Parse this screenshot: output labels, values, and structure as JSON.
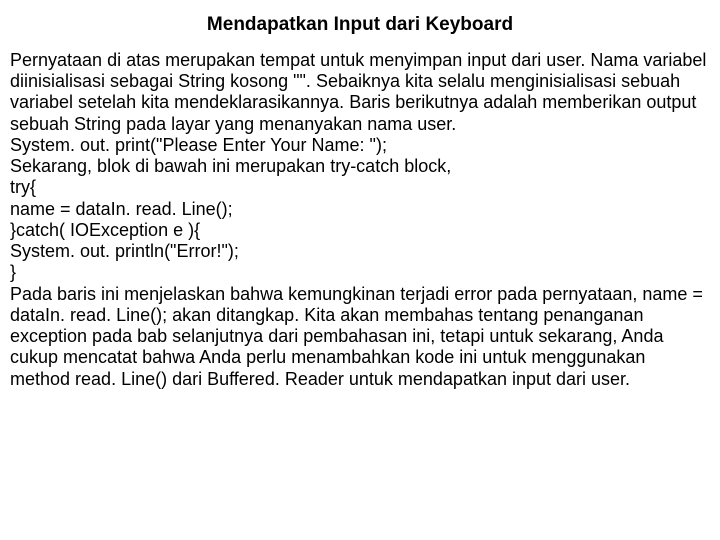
{
  "title": "Mendapatkan Input dari Keyboard",
  "lines": [
    "Pernyataan di atas merupakan tempat untuk menyimpan input dari user. Nama variabel diinisialisasi sebagai String kosong \"\". Sebaiknya kita selalu menginisialisasi sebuah variabel setelah kita mendeklarasikannya. Baris berikutnya adalah memberikan output sebuah String pada layar yang menanyakan nama user.",
    "System. out. print(\"Please Enter Your Name: \");",
    "Sekarang, blok di bawah ini merupakan try-catch block,",
    "try{",
    "name = dataIn. read. Line();",
    "}catch( IOException e ){",
    "System. out. println(\"Error!\");",
    "}",
    "Pada baris ini menjelaskan bahwa kemungkinan terjadi error pada pernyataan, name = dataIn. read. Line(); akan ditangkap. Kita akan membahas tentang penanganan exception pada bab selanjutnya dari pembahasan ini, tetapi untuk sekarang, Anda cukup mencatat bahwa Anda perlu menambahkan kode ini untuk menggunakan method read. Line() dari Buffered. Reader untuk mendapatkan input dari user."
  ]
}
